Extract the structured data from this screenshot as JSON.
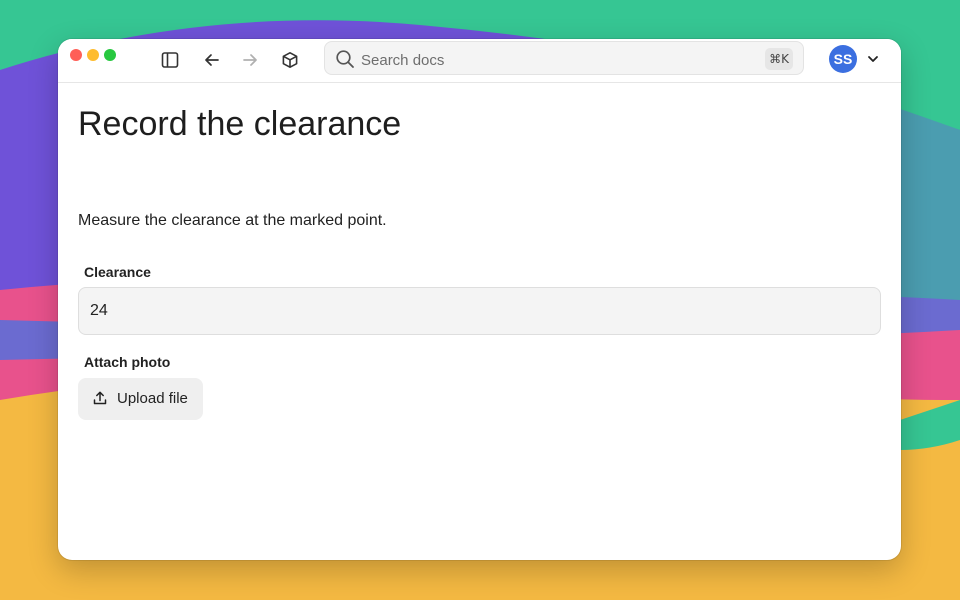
{
  "toolbar": {
    "search": {
      "placeholder": "Search docs",
      "shortcut": "⌘K"
    },
    "icons": [
      "sidebar-toggle-icon",
      "back-arrow-icon",
      "forward-arrow-icon",
      "box-icon",
      "search-icon",
      "chevron-down-icon"
    ],
    "user": {
      "initials": "SS",
      "avatar_color": "#3b6fe0"
    }
  },
  "main": {
    "title": "Record the clearance",
    "description": "Measure the clearance at the marked point.",
    "clearance": {
      "label": "Clearance",
      "value": "24"
    },
    "photo": {
      "label": "Attach photo",
      "button_label": "Upload file"
    }
  },
  "colors": {
    "wallpaper": [
      "#36c693",
      "#6f52d8",
      "#e8528c",
      "#f4b942",
      "#4b9db0"
    ],
    "traffic_lights": [
      "#ff5f57",
      "#febc2e",
      "#28c840"
    ]
  }
}
